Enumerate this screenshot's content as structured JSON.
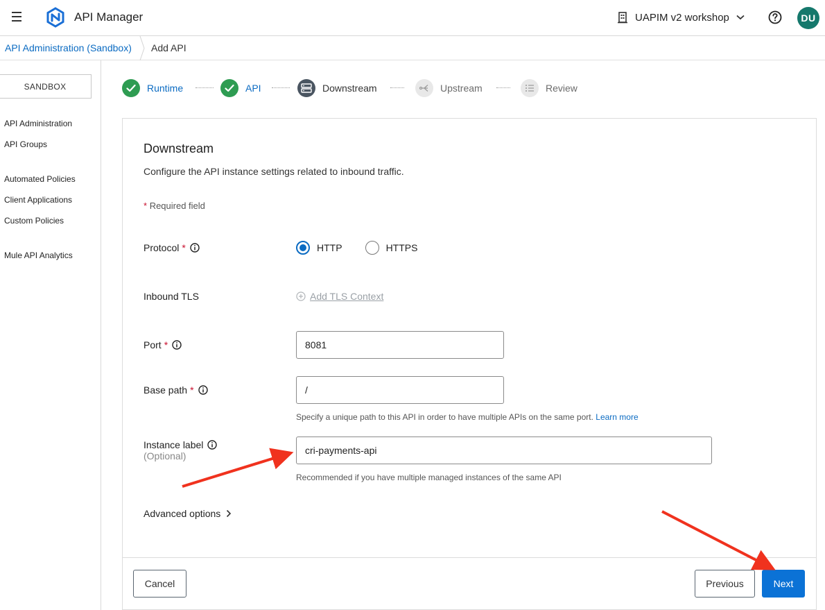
{
  "header": {
    "menu_icon": "hamburger-icon",
    "logo_icon": "hexagon-logo-icon",
    "app_title": "API Manager",
    "org_icon": "building-icon",
    "org_name": "UAPIM v2 workshop",
    "org_chevron_icon": "chevron-down-icon",
    "help_icon": "question-circle-icon",
    "avatar_initials": "DU",
    "avatar_color": "#15786c"
  },
  "breadcrumb": {
    "parent": "API Administration (Sandbox)",
    "current": "Add API"
  },
  "sidebar": {
    "environment": "SANDBOX",
    "items": [
      {
        "label": "API Administration"
      },
      {
        "label": "API Groups"
      },
      {
        "label": "Automated Policies"
      },
      {
        "label": "Client Applications"
      },
      {
        "label": "Custom Policies"
      },
      {
        "label": "Mule API Analytics"
      }
    ]
  },
  "stepper": {
    "steps": [
      {
        "label": "Runtime",
        "status": "done",
        "icon": "check-icon"
      },
      {
        "label": "API",
        "status": "done",
        "icon": "check-icon"
      },
      {
        "label": "Downstream",
        "status": "active",
        "icon": "downstream-icon"
      },
      {
        "label": "Upstream",
        "status": "todo",
        "icon": "upstream-icon"
      },
      {
        "label": "Review",
        "status": "todo",
        "icon": "list-icon"
      }
    ]
  },
  "form": {
    "title": "Downstream",
    "description": "Configure the API instance settings related to inbound traffic.",
    "required_note": "Required field",
    "required_star": "*",
    "protocol": {
      "label": "Protocol",
      "options": [
        "HTTP",
        "HTTPS"
      ],
      "selected": "HTTP"
    },
    "inbound_tls": {
      "label": "Inbound TLS",
      "add_link": "Add TLS Context"
    },
    "port": {
      "label": "Port",
      "value": "8081"
    },
    "base_path": {
      "label": "Base path",
      "value": "/",
      "helper": "Specify a unique path to this API in order to have multiple APIs on the same port.",
      "learn_more": "Learn more"
    },
    "instance_label": {
      "label": "Instance label",
      "optional": "(Optional)",
      "value": "cri-payments-api",
      "helper": "Recommended if you have multiple managed instances of the same API"
    },
    "advanced_options": "Advanced options"
  },
  "footer": {
    "cancel": "Cancel",
    "previous": "Previous",
    "next": "Next"
  },
  "colors": {
    "accent": "#0b72d6",
    "link": "#0b6bc2",
    "success": "#2e9c52",
    "required": "#c8102e",
    "annotation_arrow": "#f0321e"
  }
}
